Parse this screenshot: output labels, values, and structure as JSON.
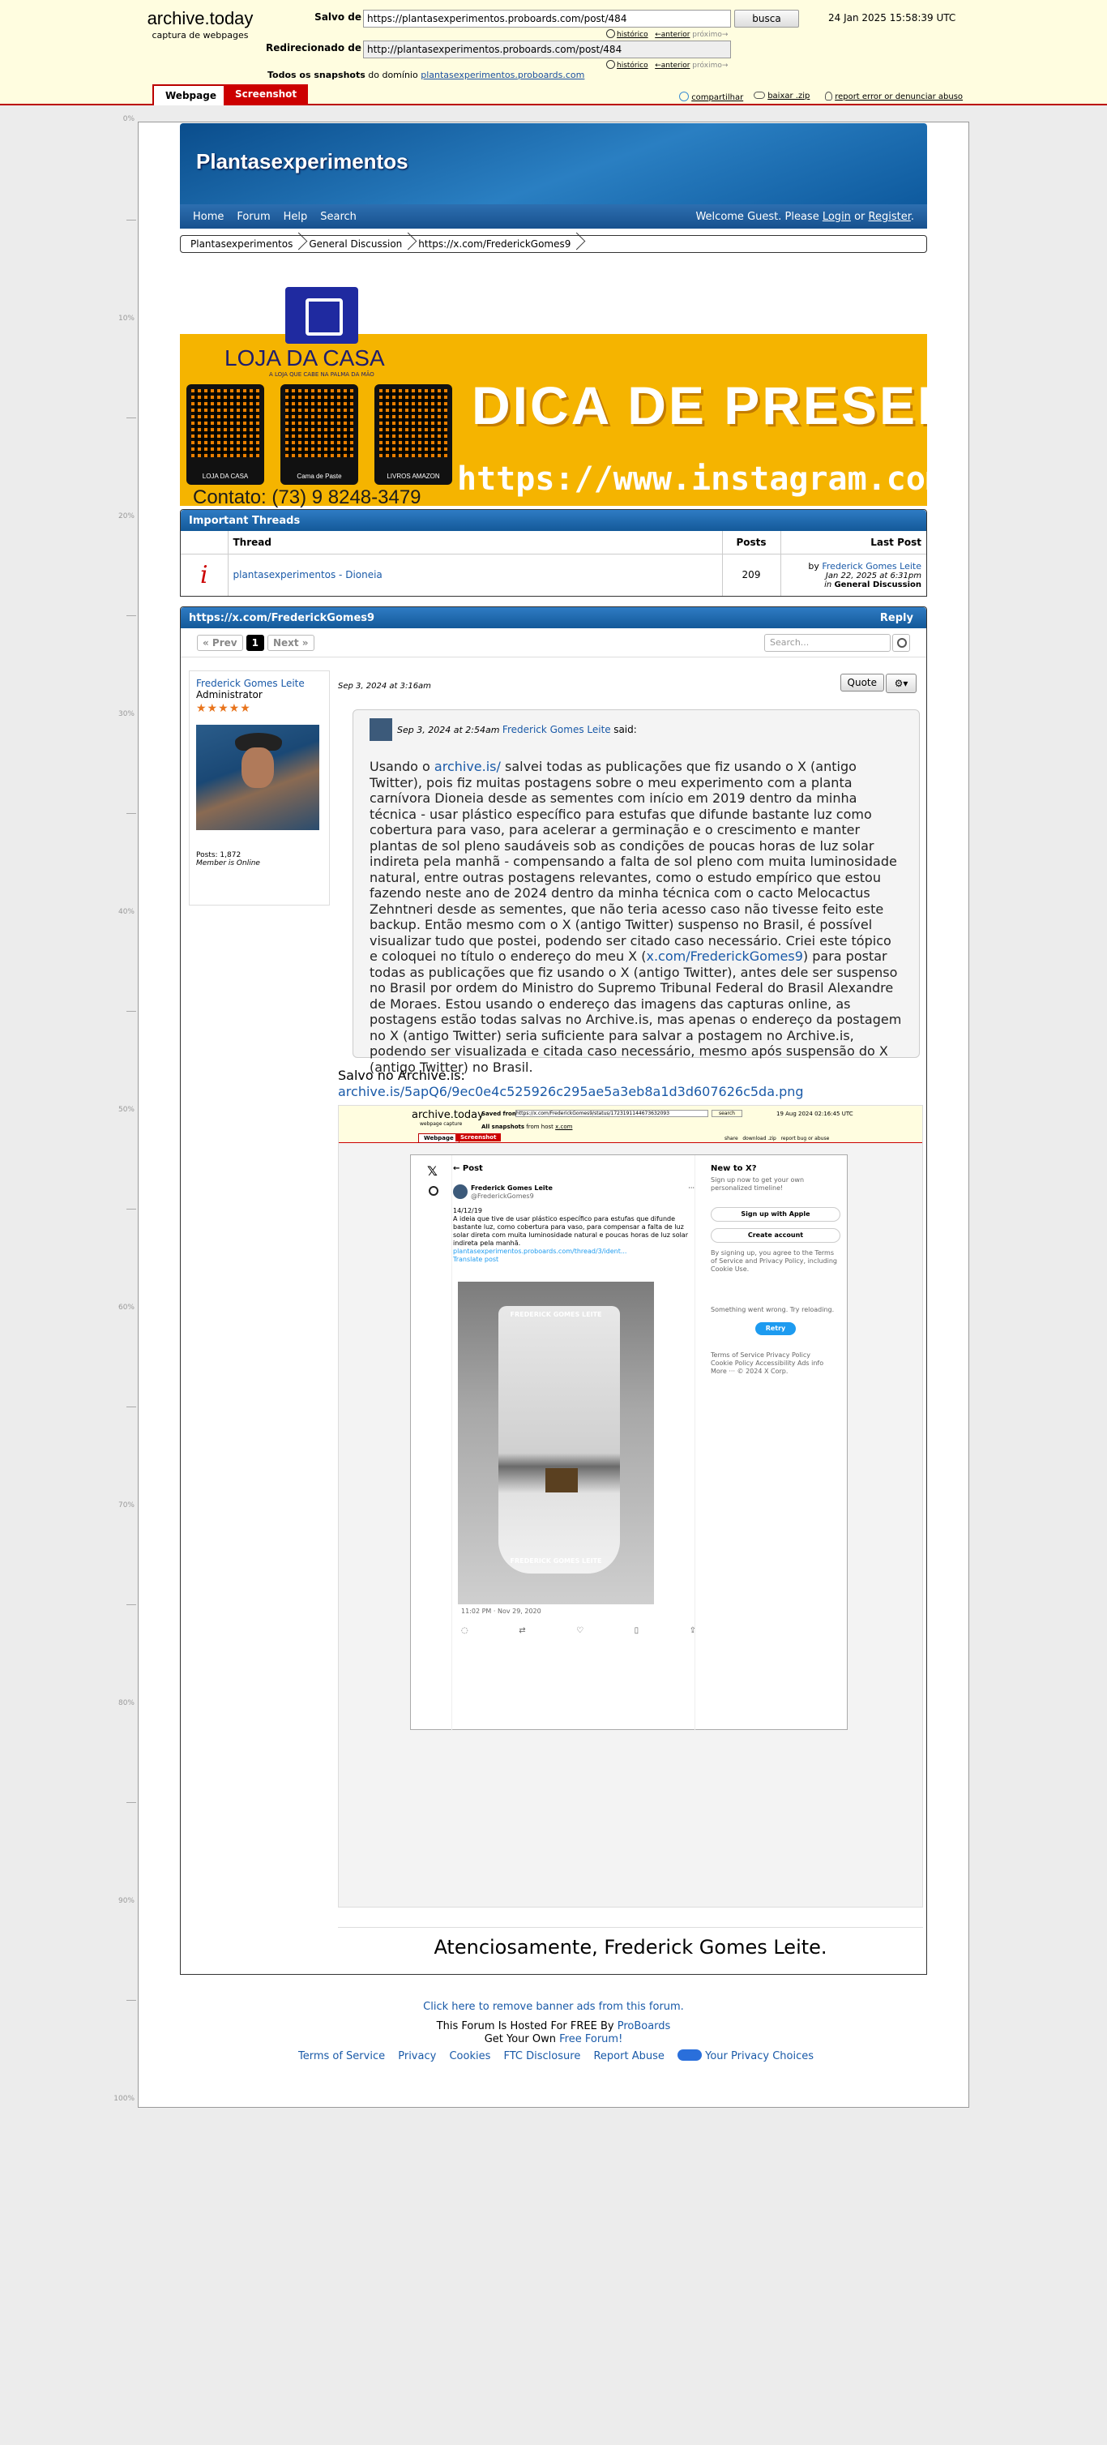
{
  "archive": {
    "brand_title": "archive.today",
    "brand_subtitle": "captura de webpages",
    "saved_from_label": "Salvo de",
    "saved_from_url": "https://plantasexperimentos.proboards.com/post/484",
    "search_button": "busca",
    "timestamp": "24 Jan 2025 15:58:39 UTC",
    "history_link": "histórico",
    "previous_link": "←anterior",
    "next_link": "próximo→",
    "redirected_label": "Redirecionado de",
    "redirected_url": "http://plantasexperimentos.proboards.com/post/484",
    "all_snapshots_label": "Todos os snapshots",
    "all_snapshots_from": "do domínio",
    "domain_link": "plantasexperimentos.proboards.com",
    "tab_webpage": "Webpage",
    "tab_screenshot": "Screenshot",
    "share_link": "compartilhar",
    "download_link": "baixar .zip",
    "report_link": "report error or denunciar abuso"
  },
  "scale": [
    "0%",
    "10%",
    "20%",
    "30%",
    "40%",
    "50%",
    "60%",
    "70%",
    "80%",
    "90%",
    "100%"
  ],
  "forum": {
    "site_name": "Plantasexperimentos",
    "nav": [
      "Home",
      "Forum",
      "Help",
      "Search"
    ],
    "welcome_prefix": "Welcome Guest. Please",
    "login": "Login",
    "or": "or",
    "register": "Register",
    "breadcrumb": [
      "Plantasexperimentos",
      "General Discussion",
      "https://x.com/FrederickGomes9"
    ]
  },
  "ad": {
    "logo_text": "LOJA DA CASA",
    "logo_sub": "A LOJA QUE CABE NA PALMA DA MÃO",
    "qr1": "LOJA DA CASA",
    "qr2": "Cama de Paste",
    "qr3": "LIVROS AMAZON",
    "headline": "DICA DE PRESENTE",
    "instagram": "https://www.instagram.com/lo",
    "contact": "Contato: (73) 9 8248-3479"
  },
  "important": {
    "title": "Important Threads",
    "col_thread": "Thread",
    "col_posts": "Posts",
    "col_last": "Last Post",
    "icon": "i",
    "thread_title": "plantasexperimentos - Dioneia",
    "posts": "209",
    "last_by": "by",
    "last_user": "Frederick Gomes Leite",
    "last_date": "Jan 22, 2025 at 6:31pm",
    "last_in": "in",
    "last_board": "General Discussion"
  },
  "thread": {
    "title": "https://x.com/FrederickGomes9",
    "reply": "Reply",
    "prev": "« Prev",
    "page": "1",
    "next": "Next »",
    "search_placeholder": "Search..."
  },
  "post": {
    "author": "Frederick Gomes Leite",
    "role": "Administrator",
    "stars": "★★★★★",
    "posts_count": "Posts: 1,872",
    "online": "Member is Online",
    "date": "Sep 3, 2024 at 3:16am",
    "quote_btn": "Quote",
    "quote_date": "Sep 3, 2024 at 2:54am",
    "quote_author": "Frederick Gomes Leite",
    "quote_said": "said:",
    "q_p1": "Usando o",
    "q_link1": "archive.is/",
    "q_p2": "salvei todas as publicações que fiz usando o X (antigo Twitter), pois fiz muitas postagens sobre o meu experimento com a planta carnívora Dioneia desde as sementes com início em 2019 dentro da minha técnica - usar plástico específico para estufas que difunde bastante luz como cobertura para vaso, para acelerar a germinação e o crescimento e manter plantas de sol pleno saudáveis sob as condições de poucas horas de luz solar indireta pela manhã - compensando a falta de sol pleno com muita luminosidade natural, entre outras postagens relevantes, como o estudo empírico que estou fazendo neste ano de 2024 dentro da minha técnica com o cacto Melocactus Zehntneri desde as sementes, que não teria acesso caso não tivesse feito este backup. Então mesmo com o X (antigo Twitter) suspenso no Brasil, é possível visualizar tudo que postei, podendo ser citado caso necessário. Criei este tópico e coloquei no título o endereço do meu X (",
    "q_link2": "x.com/FrederickGomes9",
    "q_p3": ") para postar todas as publicações que fiz usando o X (antigo Twitter), antes dele ser suspenso no Brasil por ordem do Ministro do Supremo Tribunal Federal do Brasil Alexandre de Moraes. Estou usando o endereço das imagens das capturas online, as postagens estão todas salvas no Archive.is, mas apenas o endereço da postagem no X (antigo Twitter) seria suficiente para salvar a postagem no Archive.is, podendo ser visualizada e citada caso necessário, mesmo após suspensão do X (antigo Twitter) no Brasil.",
    "saved_label": "Salvo no Archive.is:",
    "saved_link": "archive.is/5apQ6/9ec0e4c525926c295ae5a3eb8a1d3d607626c5da.png",
    "signature": "Atenciosamente, Frederick Gomes Leite."
  },
  "embedded": {
    "brand": "archive.today",
    "brand_sub": "webpage capture",
    "saved_from": "Saved from",
    "url": "https://x.com/FrederickGomes9/status/1723191144673632093",
    "search": "search",
    "date": "19 Aug 2024 02:16:45 UTC",
    "all_snap": "All snapshots",
    "from_host": "from host",
    "host": "x.com",
    "tab1": "Webpage",
    "tab2": "Screenshot",
    "share": "share",
    "download": "download .zip",
    "report": "report bug or abuse",
    "post_header": "Post",
    "name": "Frederick Gomes Leite",
    "handle": "@FrederickGomes9",
    "date_line": "14/12/19",
    "text": "A ideia que tive de usar plástico específico para estufas que difunde bastante luz, como cobertura para vaso, para compensar a falta de luz solar direta com muita luminosidade natural e poucas horas de luz solar indireta pela manhã.",
    "link": "plantasexperimentos.proboards.com/thread/3/ident...",
    "translate": "Translate post",
    "watermark": "FREDERICK GOMES LEITE",
    "time": "11:02 PM · Nov 29, 2020",
    "new_title": "New to X?",
    "new_sub": "Sign up now to get your own personalized timeline!",
    "apple": "Sign up with Apple",
    "create": "Create account",
    "terms": "By signing up, you agree to the Terms of Service and Privacy Policy, including Cookie Use.",
    "wrong": "Something went wrong. Try reloading.",
    "retry": "Retry",
    "links1": "Terms of Service   Privacy Policy",
    "links2": "Cookie Policy   Accessibility   Ads info",
    "links3": "More ···   © 2024 X Corp."
  },
  "footer": {
    "remove_ads": "Click here to remove banner ads from this forum.",
    "hosted": "This Forum Is Hosted For FREE By",
    "proboards": "ProBoards",
    "get_own": "Get Your Own",
    "free_forum": "Free Forum!",
    "links": [
      "Terms of Service",
      "Privacy",
      "Cookies",
      "FTC Disclosure",
      "Report Abuse"
    ],
    "privacy_choices": "Your Privacy Choices"
  }
}
